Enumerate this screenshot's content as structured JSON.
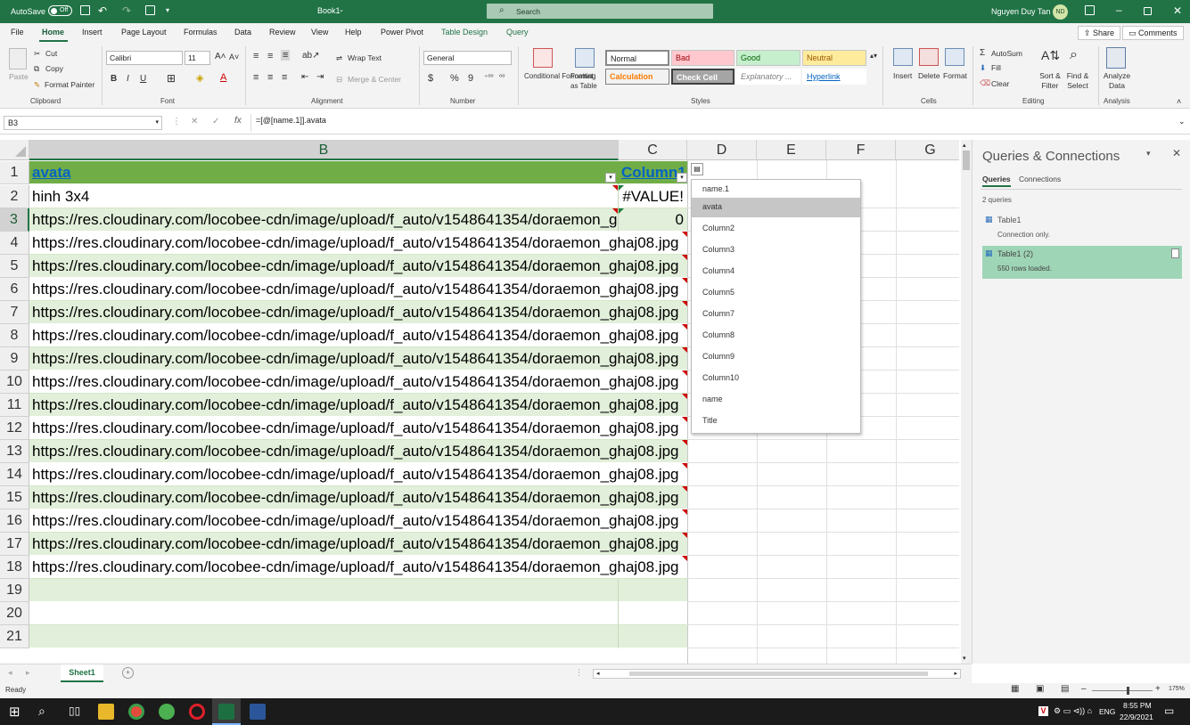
{
  "titlebar": {
    "autosave_label": "AutoSave",
    "autosave_state": "Off",
    "doc_title": "Book1",
    "search_placeholder": "Search",
    "user_name": "Nguyen Duy Tan",
    "user_initials": "ND"
  },
  "ribbon_tabs": [
    "File",
    "Home",
    "Insert",
    "Page Layout",
    "Formulas",
    "Data",
    "Review",
    "View",
    "Help",
    "Power Pivot",
    "Table Design",
    "Query"
  ],
  "share_label": "Share",
  "comments_label": "Comments",
  "ribbon": {
    "clipboard": {
      "paste": "Paste",
      "cut": "Cut",
      "copy": "Copy",
      "format_painter": "Format Painter",
      "group": "Clipboard"
    },
    "font": {
      "name": "Calibri",
      "size": "11",
      "group": "Font"
    },
    "alignment": {
      "wrap": "Wrap Text",
      "merge": "Merge & Center",
      "group": "Alignment"
    },
    "number": {
      "format": "General",
      "group": "Number"
    },
    "styles": {
      "conditional": "Conditional Formatting",
      "format_table": "Format as Table",
      "normal": "Normal",
      "bad": "Bad",
      "good": "Good",
      "neutral": "Neutral",
      "calculation": "Calculation",
      "check_cell": "Check Cell",
      "explanatory": "Explanatory ...",
      "hyperlink": "Hyperlink",
      "group": "Styles"
    },
    "cells": {
      "insert": "Insert",
      "delete": "Delete",
      "format": "Format",
      "group": "Cells"
    },
    "editing": {
      "autosum": "AutoSum",
      "fill": "Fill",
      "clear": "Clear",
      "sort": "Sort & Filter",
      "find": "Find & Select",
      "group": "Editing"
    },
    "analysis": {
      "analyze": "Analyze Data",
      "group": "Analysis"
    }
  },
  "formula_bar": {
    "name_box": "B3",
    "formula": "=[@[name.1]].avata"
  },
  "grid": {
    "columns": [
      "B",
      "C",
      "D",
      "E",
      "F",
      "G"
    ],
    "header_row": {
      "b": "avata",
      "c": "Column1"
    },
    "rows": [
      {
        "num": "2",
        "b": "hinh 3x4",
        "c": "#VALUE!"
      },
      {
        "num": "3",
        "b": "https://res.cloudinary.com/locobee-cdn/image/upload/f_auto/v1548641354/doraemon_ghaj08.jpg",
        "c": "0"
      },
      {
        "num": "4",
        "b": "https://res.cloudinary.com/locobee-cdn/image/upload/f_auto/v1548641354/doraemon_ghaj08.jpg",
        "c": ""
      },
      {
        "num": "5",
        "b": "https://res.cloudinary.com/locobee-cdn/image/upload/f_auto/v1548641354/doraemon_ghaj08.jpg",
        "c": ""
      },
      {
        "num": "6",
        "b": "https://res.cloudinary.com/locobee-cdn/image/upload/f_auto/v1548641354/doraemon_ghaj08.jpg",
        "c": ""
      },
      {
        "num": "7",
        "b": "https://res.cloudinary.com/locobee-cdn/image/upload/f_auto/v1548641354/doraemon_ghaj08.jpg",
        "c": ""
      },
      {
        "num": "8",
        "b": "https://res.cloudinary.com/locobee-cdn/image/upload/f_auto/v1548641354/doraemon_ghaj08.jpg",
        "c": ""
      },
      {
        "num": "9",
        "b": "https://res.cloudinary.com/locobee-cdn/image/upload/f_auto/v1548641354/doraemon_ghaj08.jpg",
        "c": ""
      },
      {
        "num": "10",
        "b": "https://res.cloudinary.com/locobee-cdn/image/upload/f_auto/v1548641354/doraemon_ghaj08.jpg",
        "c": ""
      },
      {
        "num": "11",
        "b": "https://res.cloudinary.com/locobee-cdn/image/upload/f_auto/v1548641354/doraemon_ghaj08.jpg",
        "c": ""
      },
      {
        "num": "12",
        "b": "https://res.cloudinary.com/locobee-cdn/image/upload/f_auto/v1548641354/doraemon_ghaj08.jpg",
        "c": ""
      },
      {
        "num": "13",
        "b": "https://res.cloudinary.com/locobee-cdn/image/upload/f_auto/v1548641354/doraemon_ghaj08.jpg",
        "c": ""
      },
      {
        "num": "14",
        "b": "https://res.cloudinary.com/locobee-cdn/image/upload/f_auto/v1548641354/doraemon_ghaj08.jpg",
        "c": ""
      },
      {
        "num": "15",
        "b": "https://res.cloudinary.com/locobee-cdn/image/upload/f_auto/v1548641354/doraemon_ghaj08.jpg",
        "c": ""
      },
      {
        "num": "16",
        "b": "https://res.cloudinary.com/locobee-cdn/image/upload/f_auto/v1548641354/doraemon_ghaj08.jpg",
        "c": ""
      },
      {
        "num": "17",
        "b": "https://res.cloudinary.com/locobee-cdn/image/upload/f_auto/v1548641354/doraemon_ghaj08.jpg",
        "c": ""
      },
      {
        "num": "18",
        "b": "https://res.cloudinary.com/locobee-cdn/image/upload/f_auto/v1548641354/doraemon_ghaj08.jpg",
        "c": ""
      },
      {
        "num": "19",
        "b": "",
        "c": ""
      },
      {
        "num": "20",
        "b": "",
        "c": ""
      },
      {
        "num": "21",
        "b": "",
        "c": ""
      }
    ],
    "first_row_num": "1"
  },
  "autocomplete": {
    "header": "name.1",
    "items": [
      "avata",
      "Column2",
      "Column3",
      "Column4",
      "Column5",
      "Column7",
      "Column8",
      "Column9",
      "Column10",
      "name",
      "Title"
    ],
    "selected": "avata"
  },
  "sheet_tabs": [
    "Sheet1"
  ],
  "status": {
    "mode": "Ready",
    "zoom": "175%"
  },
  "queries_pane": {
    "title": "Queries & Connections",
    "tab_queries": "Queries",
    "tab_connections": "Connections",
    "count": "2 queries",
    "items": [
      {
        "name": "Table1",
        "detail": "Connection only."
      },
      {
        "name": "Table1 (2)",
        "detail": "550 rows loaded."
      }
    ]
  },
  "taskbar": {
    "lang": "ENG",
    "time": "8:55 PM",
    "date": "22/9/2021"
  },
  "colors": {
    "excel_green": "#217346",
    "band": "#e2efda",
    "header_green": "#70ad47",
    "link": "#0563c1"
  }
}
